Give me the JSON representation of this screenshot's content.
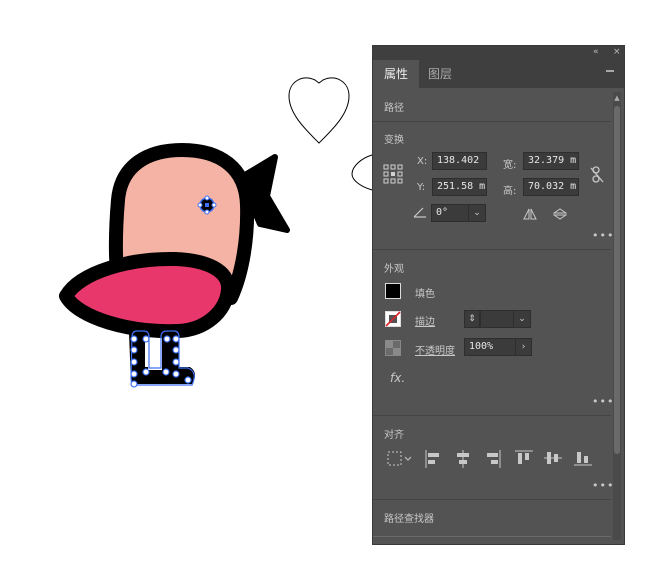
{
  "panel": {
    "controls": {
      "collapse": "«",
      "close": "×"
    },
    "tabs": [
      "属性",
      "图层"
    ],
    "sections": {
      "path": {
        "title": "路径"
      },
      "transform": {
        "title": "变换",
        "x_label": "X:",
        "x_value": "138.402",
        "y_label": "Y:",
        "y_value": "251.58 m",
        "w_label": "宽:",
        "w_value": "32.379 m",
        "h_label": "高:",
        "h_value": "70.032 m",
        "angle_value": "0°"
      },
      "appearance": {
        "title": "外观",
        "fill_label": "填色",
        "stroke_label": "描边",
        "opacity_label": "不透明度",
        "opacity_value": "100%",
        "fx_label": "fx."
      },
      "align": {
        "title": "对齐"
      },
      "pathfinder": {
        "title": "路径查找器"
      }
    },
    "more_label": "•••"
  },
  "colors": {
    "panel_bg": "#535353",
    "bird_body": "#f4b3a5",
    "bird_wing": "#e8386b",
    "outline": "#000000",
    "selection": "#3d6ff2"
  }
}
